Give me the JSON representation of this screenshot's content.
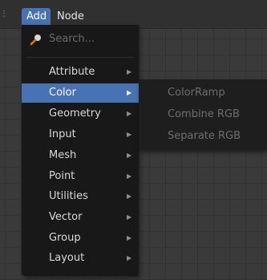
{
  "header": {
    "tabs": [
      {
        "label": "Add"
      },
      {
        "label": "Node"
      }
    ]
  },
  "add_menu": {
    "search_placeholder": "Search...",
    "items": [
      {
        "label": "Attribute"
      },
      {
        "label": "Color"
      },
      {
        "label": "Geometry"
      },
      {
        "label": "Input"
      },
      {
        "label": "Mesh"
      },
      {
        "label": "Point"
      },
      {
        "label": "Utilities"
      },
      {
        "label": "Vector"
      },
      {
        "label": "Group"
      },
      {
        "label": "Layout"
      }
    ],
    "active_item": "Color",
    "arrow_glyph": "▶"
  },
  "color_submenu": {
    "items": [
      {
        "label": "ColorRamp"
      },
      {
        "label": "Combine RGB"
      },
      {
        "label": "Separate RGB"
      }
    ]
  },
  "colors": {
    "accent": "#4772b3",
    "menu_bg": "#181818",
    "header_bg": "#303030"
  },
  "icons": {
    "search": "search-icon",
    "submenu_arrow": "submenu-arrow-icon"
  }
}
